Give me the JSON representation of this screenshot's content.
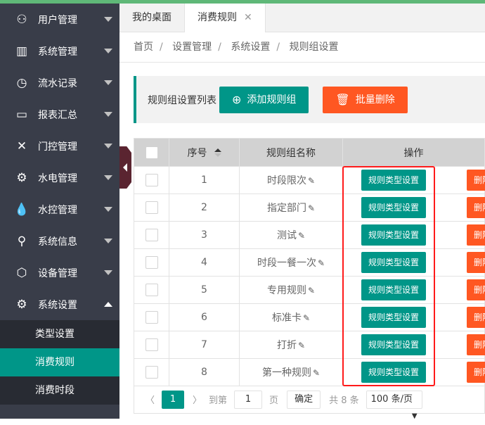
{
  "colors": {
    "accent": "#009688",
    "danger": "#ff5722",
    "sidebar": "#393d49",
    "highlight": "#ff1a1a"
  },
  "sidebar": {
    "items": [
      {
        "label": "用户管理",
        "icon": "user-icon"
      },
      {
        "label": "系统管理",
        "icon": "system-icon"
      },
      {
        "label": "流水记录",
        "icon": "clock-icon"
      },
      {
        "label": "报表汇总",
        "icon": "report-icon"
      },
      {
        "label": "门控管理",
        "icon": "close-icon"
      },
      {
        "label": "水电管理",
        "icon": "power-icon"
      },
      {
        "label": "水控管理",
        "icon": "water-icon"
      },
      {
        "label": "系统信息",
        "icon": "search-icon"
      },
      {
        "label": "设备管理",
        "icon": "cube-icon"
      },
      {
        "label": "系统设置",
        "icon": "gear-icon"
      }
    ],
    "sub_items": [
      {
        "label": "类型设置"
      },
      {
        "label": "消费规则",
        "active": true
      },
      {
        "label": "消费时段"
      }
    ]
  },
  "tabs": [
    {
      "label": "我的桌面"
    },
    {
      "label": "消费规则",
      "active": true
    }
  ],
  "breadcrumb": [
    "首页",
    "设置管理",
    "系统设置",
    "规则组设置"
  ],
  "toolbar": {
    "label": "规则组设置列表",
    "add": "添加规则组",
    "batch_delete": "批量删除"
  },
  "table": {
    "headers": [
      "序号",
      "规则组名称",
      "操作"
    ],
    "rows": [
      {
        "no": "1",
        "name": "时段限次"
      },
      {
        "no": "2",
        "name": "指定部门"
      },
      {
        "no": "3",
        "name": "测试"
      },
      {
        "no": "4",
        "name": "时段一餐一次"
      },
      {
        "no": "5",
        "name": "专用规则"
      },
      {
        "no": "6",
        "name": "标准卡"
      },
      {
        "no": "7",
        "name": "打折"
      },
      {
        "no": "8",
        "name": "第一种规则"
      }
    ],
    "setting_label": "规则类型设置",
    "delete_label": "删除"
  },
  "pager": {
    "current": "1",
    "goto": "到第",
    "page_input": "1",
    "page_unit": "页",
    "confirm": "确定",
    "total": "共 8 条",
    "page_size": "100 条/页"
  }
}
